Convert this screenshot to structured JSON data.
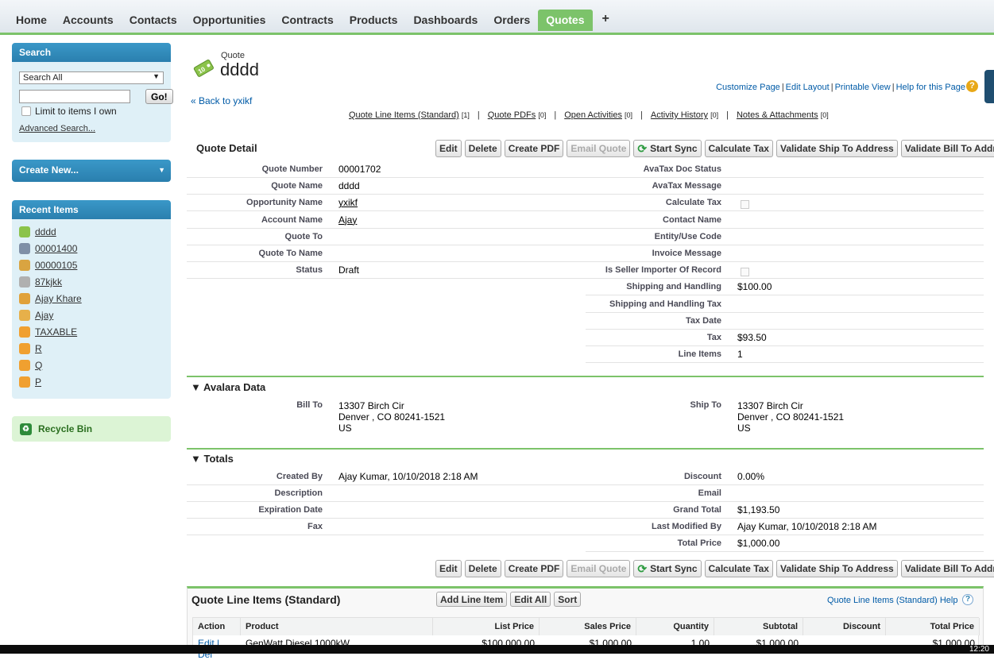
{
  "tabs": [
    "Home",
    "Accounts",
    "Contacts",
    "Opportunities",
    "Contracts",
    "Products",
    "Dashboards",
    "Orders",
    "Quotes",
    "+"
  ],
  "active_tab": "Quotes",
  "sidebar": {
    "search_title": "Search",
    "search_scope": "Search All",
    "go_label": "Go!",
    "limit_label": "Limit to items I own",
    "advanced_label": "Advanced Search...",
    "create_new_label": "Create New...",
    "recent_title": "Recent Items",
    "recent_items": [
      {
        "label": "dddd",
        "icon": "quote-icon",
        "color": "#8bc34a"
      },
      {
        "label": "00001400",
        "icon": "order-icon",
        "color": "#7f8fa6"
      },
      {
        "label": "00000105",
        "icon": "contract-icon",
        "color": "#d9a441"
      },
      {
        "label": "87kjkk",
        "icon": "opportunity-icon",
        "color": "#b0b0b0"
      },
      {
        "label": "Ajay Khare",
        "icon": "contact-icon",
        "color": "#e0a13a"
      },
      {
        "label": "Ajay",
        "icon": "account-icon",
        "color": "#e7b04a"
      },
      {
        "label": "TAXABLE",
        "icon": "product-icon",
        "color": "#f0a030"
      },
      {
        "label": "R",
        "icon": "product-icon",
        "color": "#f0a030"
      },
      {
        "label": "Q",
        "icon": "product-icon",
        "color": "#f0a030"
      },
      {
        "label": "P",
        "icon": "product-icon",
        "color": "#f0a030"
      }
    ],
    "recycle_label": "Recycle Bin"
  },
  "header": {
    "object_type": "Quote",
    "record_name": "dddd",
    "links": [
      "Customize Page",
      "Edit Layout",
      "Printable View",
      "Help for this Page"
    ],
    "back_link": "« Back to yxikf"
  },
  "related_links": [
    {
      "label": "Quote Line Items (Standard)",
      "count": "[1]"
    },
    {
      "label": "Quote PDFs",
      "count": "[0]"
    },
    {
      "label": "Open Activities",
      "count": "[0]"
    },
    {
      "label": "Activity History",
      "count": "[0]"
    },
    {
      "label": "Notes & Attachments",
      "count": "[0]"
    }
  ],
  "detail_title": "Quote Detail",
  "buttons": [
    "Edit",
    "Delete",
    "Create PDF",
    "Email Quote",
    "Start Sync",
    "Calculate Tax",
    "Validate Ship To Address",
    "Validate Bill To Address"
  ],
  "left_fields": [
    {
      "label": "Quote Number",
      "value": "00001702"
    },
    {
      "label": "Quote Name",
      "value": "dddd"
    },
    {
      "label": "Opportunity Name",
      "value": "yxikf",
      "link": true
    },
    {
      "label": "Account Name",
      "value": "Ajay",
      "link": true
    },
    {
      "label": "Quote To",
      "value": ""
    },
    {
      "label": "Quote To Name",
      "value": ""
    },
    {
      "label": "Status",
      "value": "Draft"
    }
  ],
  "right_fields": [
    {
      "label": "AvaTax Doc Status",
      "value": ""
    },
    {
      "label": "AvaTax Message",
      "value": ""
    },
    {
      "label": "Calculate Tax",
      "value": "",
      "checkbox": true
    },
    {
      "label": "Contact Name",
      "value": ""
    },
    {
      "label": "Entity/Use Code",
      "value": ""
    },
    {
      "label": "Invoice Message",
      "value": ""
    },
    {
      "label": "Is Seller Importer Of Record",
      "value": "",
      "checkbox": true
    },
    {
      "label": "Shipping and Handling",
      "value": "$100.00"
    },
    {
      "label": "Shipping and Handling Tax",
      "value": ""
    },
    {
      "label": "Tax Date",
      "value": ""
    },
    {
      "label": "Tax",
      "value": "$93.50"
    },
    {
      "label": "Line Items",
      "value": "1"
    }
  ],
  "avalara": {
    "title": "Avalara Data",
    "bill_to_label": "Bill To",
    "bill_to": [
      "13307 Birch Cir",
      "Denver , CO 80241-1521",
      "US"
    ],
    "ship_to_label": "Ship To",
    "ship_to": [
      "13307 Birch Cir",
      "Denver , CO 80241-1521",
      "US"
    ]
  },
  "totals": {
    "title": "Totals",
    "left": [
      {
        "label": "Created By",
        "value": "Ajay Kumar",
        "suffix": ", 10/10/2018 2:18 AM"
      },
      {
        "label": "Description",
        "value": ""
      },
      {
        "label": "Expiration Date",
        "value": ""
      },
      {
        "label": "Fax",
        "value": ""
      }
    ],
    "right": [
      {
        "label": "Discount",
        "value": "0.00%"
      },
      {
        "label": "Email",
        "value": ""
      },
      {
        "label": "Grand Total",
        "value": "$1,193.50"
      },
      {
        "label": "Last Modified By",
        "value": "Ajay Kumar",
        "suffix": ", 10/10/2018 2:18 AM"
      },
      {
        "label": "Total Price",
        "value": "$1,000.00"
      }
    ]
  },
  "line_items": {
    "title": "Quote Line Items (Standard)",
    "buttons": [
      "Add Line Item",
      "Edit All",
      "Sort"
    ],
    "help": "Quote Line Items (Standard) Help",
    "columns": [
      "Action",
      "Product",
      "List Price",
      "Sales Price",
      "Quantity",
      "Subtotal",
      "Discount",
      "Total Price"
    ],
    "row": [
      "Edit | Del",
      "GenWatt Diesel 1000kW",
      "$100,000.00",
      "$1,000.00",
      "1.00",
      "$1,000.00",
      "",
      "$1,000.00"
    ]
  },
  "clock": "12:20"
}
